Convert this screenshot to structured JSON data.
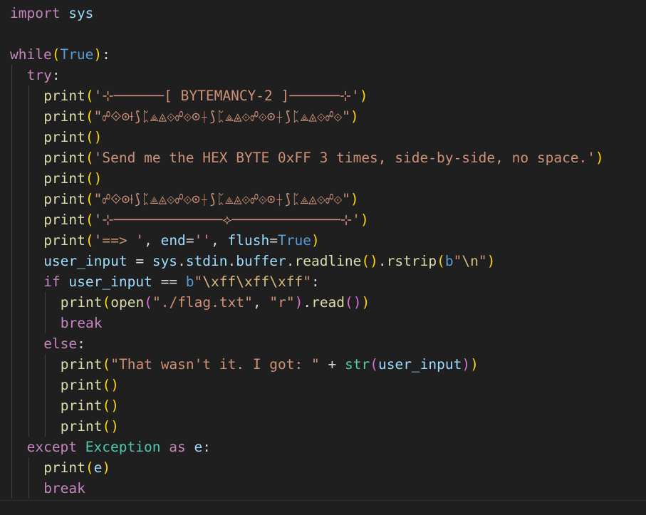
{
  "editor": {
    "colors": {
      "background": "#1f1f1f",
      "keyword": "#c586c0",
      "identifier": "#9cdcfe",
      "function": "#dcdcaa",
      "string": "#ce9178",
      "constant": "#569cd6",
      "class": "#4ec9b0",
      "escape": "#d7ba7d",
      "operator": "#d4d4d4",
      "bracket_1": "#ffd700",
      "bracket_2": "#da70d6",
      "bracket_3": "#179fff"
    },
    "lines": [
      {
        "indent": 0,
        "tokens": [
          {
            "t": "kw",
            "v": "import"
          },
          {
            "t": "op",
            "v": " "
          },
          {
            "t": "id",
            "v": "sys"
          }
        ]
      },
      {
        "indent": 0,
        "tokens": []
      },
      {
        "indent": 0,
        "tokens": [
          {
            "t": "kw",
            "v": "while"
          },
          {
            "t": "b1",
            "v": "("
          },
          {
            "t": "const",
            "v": "True"
          },
          {
            "t": "b1",
            "v": ")"
          },
          {
            "t": "op",
            "v": ":"
          }
        ]
      },
      {
        "indent": 1,
        "tokens": [
          {
            "t": "kw",
            "v": "try"
          },
          {
            "t": "op",
            "v": ":"
          }
        ]
      },
      {
        "indent": 2,
        "tokens": [
          {
            "t": "fn",
            "v": "print"
          },
          {
            "t": "b1",
            "v": "("
          },
          {
            "t": "str",
            "v": "'⊹──────[ BYTEMANCY-2 ]──────⊹'"
          },
          {
            "t": "b1",
            "v": ")"
          }
        ]
      },
      {
        "indent": 2,
        "tokens": [
          {
            "t": "fn",
            "v": "print"
          },
          {
            "t": "b1",
            "v": "("
          },
          {
            "t": "str",
            "v": "\"☍⟐⊙⟊⟆ᛈ⟁◬⟐☍⟐⊙⟊⟆ᛈ⟁◬⟐☍⟐⊙⟊⟆ᛈ⟁◬⟐☍⟐\""
          },
          {
            "t": "b1",
            "v": ")"
          }
        ]
      },
      {
        "indent": 2,
        "tokens": [
          {
            "t": "fn",
            "v": "print"
          },
          {
            "t": "b1",
            "v": "()"
          }
        ]
      },
      {
        "indent": 2,
        "tokens": [
          {
            "t": "fn",
            "v": "print"
          },
          {
            "t": "b1",
            "v": "("
          },
          {
            "t": "str",
            "v": "'Send me the HEX BYTE 0xFF 3 times, side-by-side, no space.'"
          },
          {
            "t": "b1",
            "v": ")"
          }
        ]
      },
      {
        "indent": 2,
        "tokens": [
          {
            "t": "fn",
            "v": "print"
          },
          {
            "t": "b1",
            "v": "()"
          }
        ]
      },
      {
        "indent": 2,
        "tokens": [
          {
            "t": "fn",
            "v": "print"
          },
          {
            "t": "b1",
            "v": "("
          },
          {
            "t": "str",
            "v": "\"☍⟐⊙⟊⟆ᛈ⟁◬⟐☍⟐⊙⟊⟆ᛈ⟁◬⟐☍⟐⊙⟊⟆ᛈ⟁◬⟐☍⟐\""
          },
          {
            "t": "b1",
            "v": ")"
          }
        ]
      },
      {
        "indent": 2,
        "tokens": [
          {
            "t": "fn",
            "v": "print"
          },
          {
            "t": "b1",
            "v": "("
          },
          {
            "t": "str",
            "v": "'⊹─────────────⟡─────────────⊹'"
          },
          {
            "t": "b1",
            "v": ")"
          }
        ]
      },
      {
        "indent": 2,
        "tokens": [
          {
            "t": "fn",
            "v": "print"
          },
          {
            "t": "b1",
            "v": "("
          },
          {
            "t": "str",
            "v": "'==> '"
          },
          {
            "t": "op",
            "v": ", "
          },
          {
            "t": "id",
            "v": "end"
          },
          {
            "t": "op",
            "v": "="
          },
          {
            "t": "str",
            "v": "''"
          },
          {
            "t": "op",
            "v": ", "
          },
          {
            "t": "id",
            "v": "flush"
          },
          {
            "t": "op",
            "v": "="
          },
          {
            "t": "const",
            "v": "True"
          },
          {
            "t": "b1",
            "v": ")"
          }
        ]
      },
      {
        "indent": 2,
        "tokens": [
          {
            "t": "id",
            "v": "user_input"
          },
          {
            "t": "op",
            "v": " = "
          },
          {
            "t": "id",
            "v": "sys"
          },
          {
            "t": "op",
            "v": "."
          },
          {
            "t": "id",
            "v": "stdin"
          },
          {
            "t": "op",
            "v": "."
          },
          {
            "t": "id",
            "v": "buffer"
          },
          {
            "t": "op",
            "v": "."
          },
          {
            "t": "fn",
            "v": "readline"
          },
          {
            "t": "b1",
            "v": "()"
          },
          {
            "t": "op",
            "v": "."
          },
          {
            "t": "fn",
            "v": "rstrip"
          },
          {
            "t": "b1",
            "v": "("
          },
          {
            "t": "const",
            "v": "b"
          },
          {
            "t": "str",
            "v": "\""
          },
          {
            "t": "esc",
            "v": "\\n"
          },
          {
            "t": "str",
            "v": "\""
          },
          {
            "t": "b1",
            "v": ")"
          }
        ]
      },
      {
        "indent": 2,
        "tokens": [
          {
            "t": "kw",
            "v": "if"
          },
          {
            "t": "op",
            "v": " "
          },
          {
            "t": "id",
            "v": "user_input"
          },
          {
            "t": "op",
            "v": " == "
          },
          {
            "t": "const",
            "v": "b"
          },
          {
            "t": "str",
            "v": "\""
          },
          {
            "t": "esc",
            "v": "\\xff\\xff\\xff"
          },
          {
            "t": "str",
            "v": "\""
          },
          {
            "t": "op",
            "v": ":"
          }
        ]
      },
      {
        "indent": 3,
        "tokens": [
          {
            "t": "fn",
            "v": "print"
          },
          {
            "t": "b1",
            "v": "("
          },
          {
            "t": "fn",
            "v": "open"
          },
          {
            "t": "b2",
            "v": "("
          },
          {
            "t": "str",
            "v": "\"./flag.txt\""
          },
          {
            "t": "op",
            "v": ", "
          },
          {
            "t": "str",
            "v": "\"r\""
          },
          {
            "t": "b2",
            "v": ")"
          },
          {
            "t": "op",
            "v": "."
          },
          {
            "t": "fn",
            "v": "read"
          },
          {
            "t": "b2",
            "v": "()"
          },
          {
            "t": "b1",
            "v": ")"
          }
        ]
      },
      {
        "indent": 3,
        "tokens": [
          {
            "t": "kw",
            "v": "break"
          }
        ]
      },
      {
        "indent": 2,
        "tokens": [
          {
            "t": "kw",
            "v": "else"
          },
          {
            "t": "op",
            "v": ":"
          }
        ]
      },
      {
        "indent": 3,
        "tokens": [
          {
            "t": "fn",
            "v": "print"
          },
          {
            "t": "b1",
            "v": "("
          },
          {
            "t": "str",
            "v": "\"That wasn't it. I got: \""
          },
          {
            "t": "op",
            "v": " + "
          },
          {
            "t": "cls",
            "v": "str"
          },
          {
            "t": "b2",
            "v": "("
          },
          {
            "t": "id",
            "v": "user_input"
          },
          {
            "t": "b2",
            "v": ")"
          },
          {
            "t": "b1",
            "v": ")"
          }
        ]
      },
      {
        "indent": 3,
        "tokens": [
          {
            "t": "fn",
            "v": "print"
          },
          {
            "t": "b1",
            "v": "()"
          }
        ]
      },
      {
        "indent": 3,
        "tokens": [
          {
            "t": "fn",
            "v": "print"
          },
          {
            "t": "b1",
            "v": "()"
          }
        ]
      },
      {
        "indent": 3,
        "tokens": [
          {
            "t": "fn",
            "v": "print"
          },
          {
            "t": "b1",
            "v": "()"
          }
        ]
      },
      {
        "indent": 1,
        "tokens": [
          {
            "t": "kw",
            "v": "except"
          },
          {
            "t": "op",
            "v": " "
          },
          {
            "t": "cls",
            "v": "Exception"
          },
          {
            "t": "op",
            "v": " "
          },
          {
            "t": "kw",
            "v": "as"
          },
          {
            "t": "op",
            "v": " "
          },
          {
            "t": "id",
            "v": "e"
          },
          {
            "t": "op",
            "v": ":"
          }
        ]
      },
      {
        "indent": 2,
        "tokens": [
          {
            "t": "fn",
            "v": "print"
          },
          {
            "t": "b1",
            "v": "("
          },
          {
            "t": "id",
            "v": "e"
          },
          {
            "t": "b1",
            "v": ")"
          }
        ]
      },
      {
        "indent": 2,
        "tokens": [
          {
            "t": "kw",
            "v": "break"
          }
        ]
      }
    ]
  }
}
